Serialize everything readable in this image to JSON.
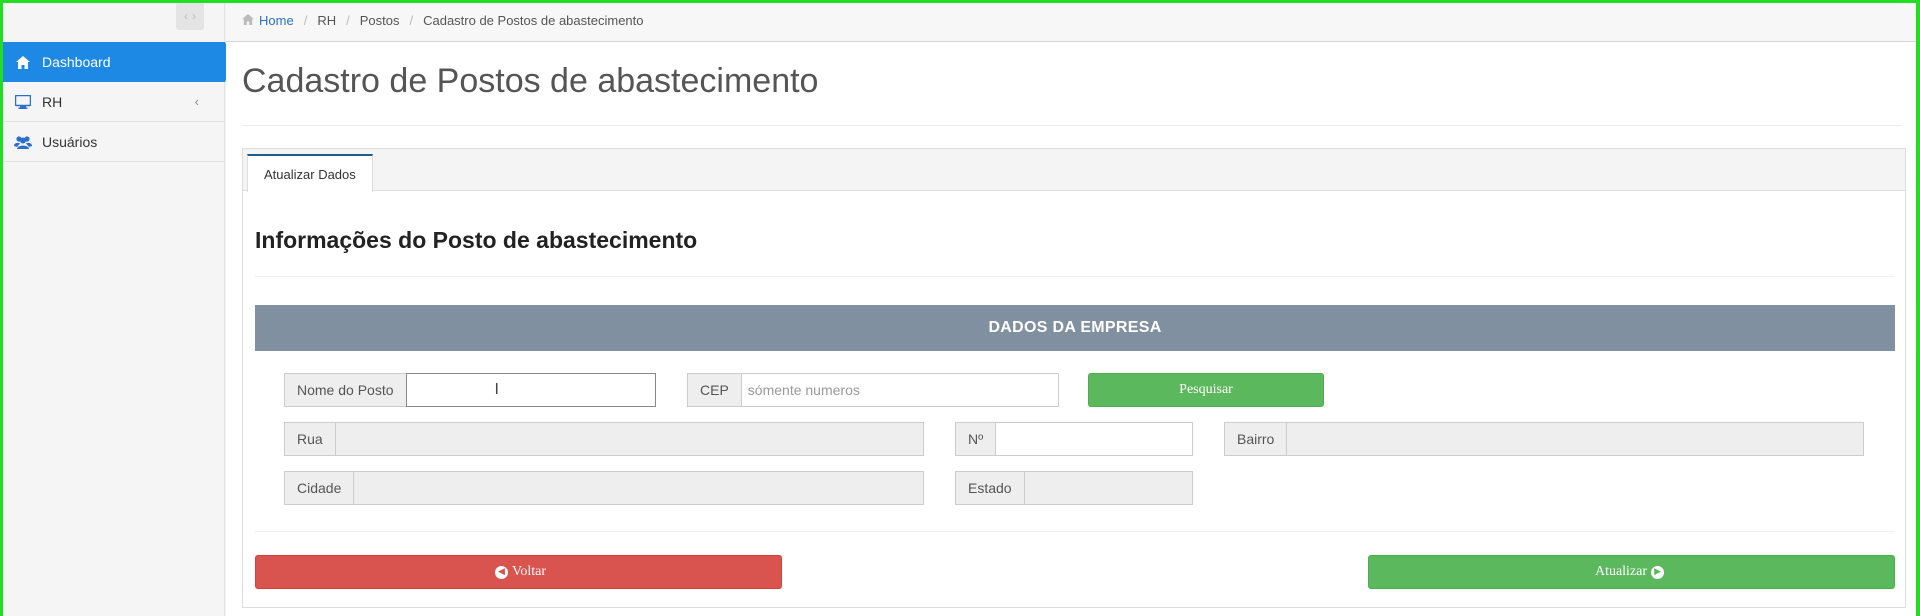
{
  "breadcrumb": {
    "home": "Home",
    "items": [
      "RH",
      "Postos",
      "Cadastro de Postos de abastecimento"
    ]
  },
  "sidebar": {
    "toggle_left": "‹",
    "toggle_right": "›",
    "items": [
      {
        "label": "Dashboard",
        "icon": "home-icon",
        "active": true
      },
      {
        "label": "RH",
        "icon": "monitor-icon",
        "chevron": "‹"
      },
      {
        "label": "Usuários",
        "icon": "users-icon"
      }
    ]
  },
  "page": {
    "title": "Cadastro de Postos de abastecimento",
    "tab_label": "Atualizar Dados",
    "section_title": "Informações do Posto de abastecimento",
    "empresa_header": "DADOS DA EMPRESA"
  },
  "form": {
    "nome_posto": {
      "label": "Nome do Posto",
      "value": ""
    },
    "cep": {
      "label": "CEP",
      "placeholder": "sómente numeros"
    },
    "pesquisar_label": "Pesquisar",
    "rua": {
      "label": "Rua",
      "value": ""
    },
    "numero": {
      "label": "Nº",
      "value": ""
    },
    "bairro": {
      "label": "Bairro",
      "value": ""
    },
    "cidade": {
      "label": "Cidade",
      "value": ""
    },
    "estado": {
      "label": "Estado",
      "value": ""
    }
  },
  "actions": {
    "voltar_label": "Voltar",
    "atualizar_label": "Atualizar"
  },
  "colors": {
    "accent": "#1e88e5",
    "success": "#5cb85c",
    "danger": "#d9534f",
    "section_bar": "#8090a0"
  }
}
